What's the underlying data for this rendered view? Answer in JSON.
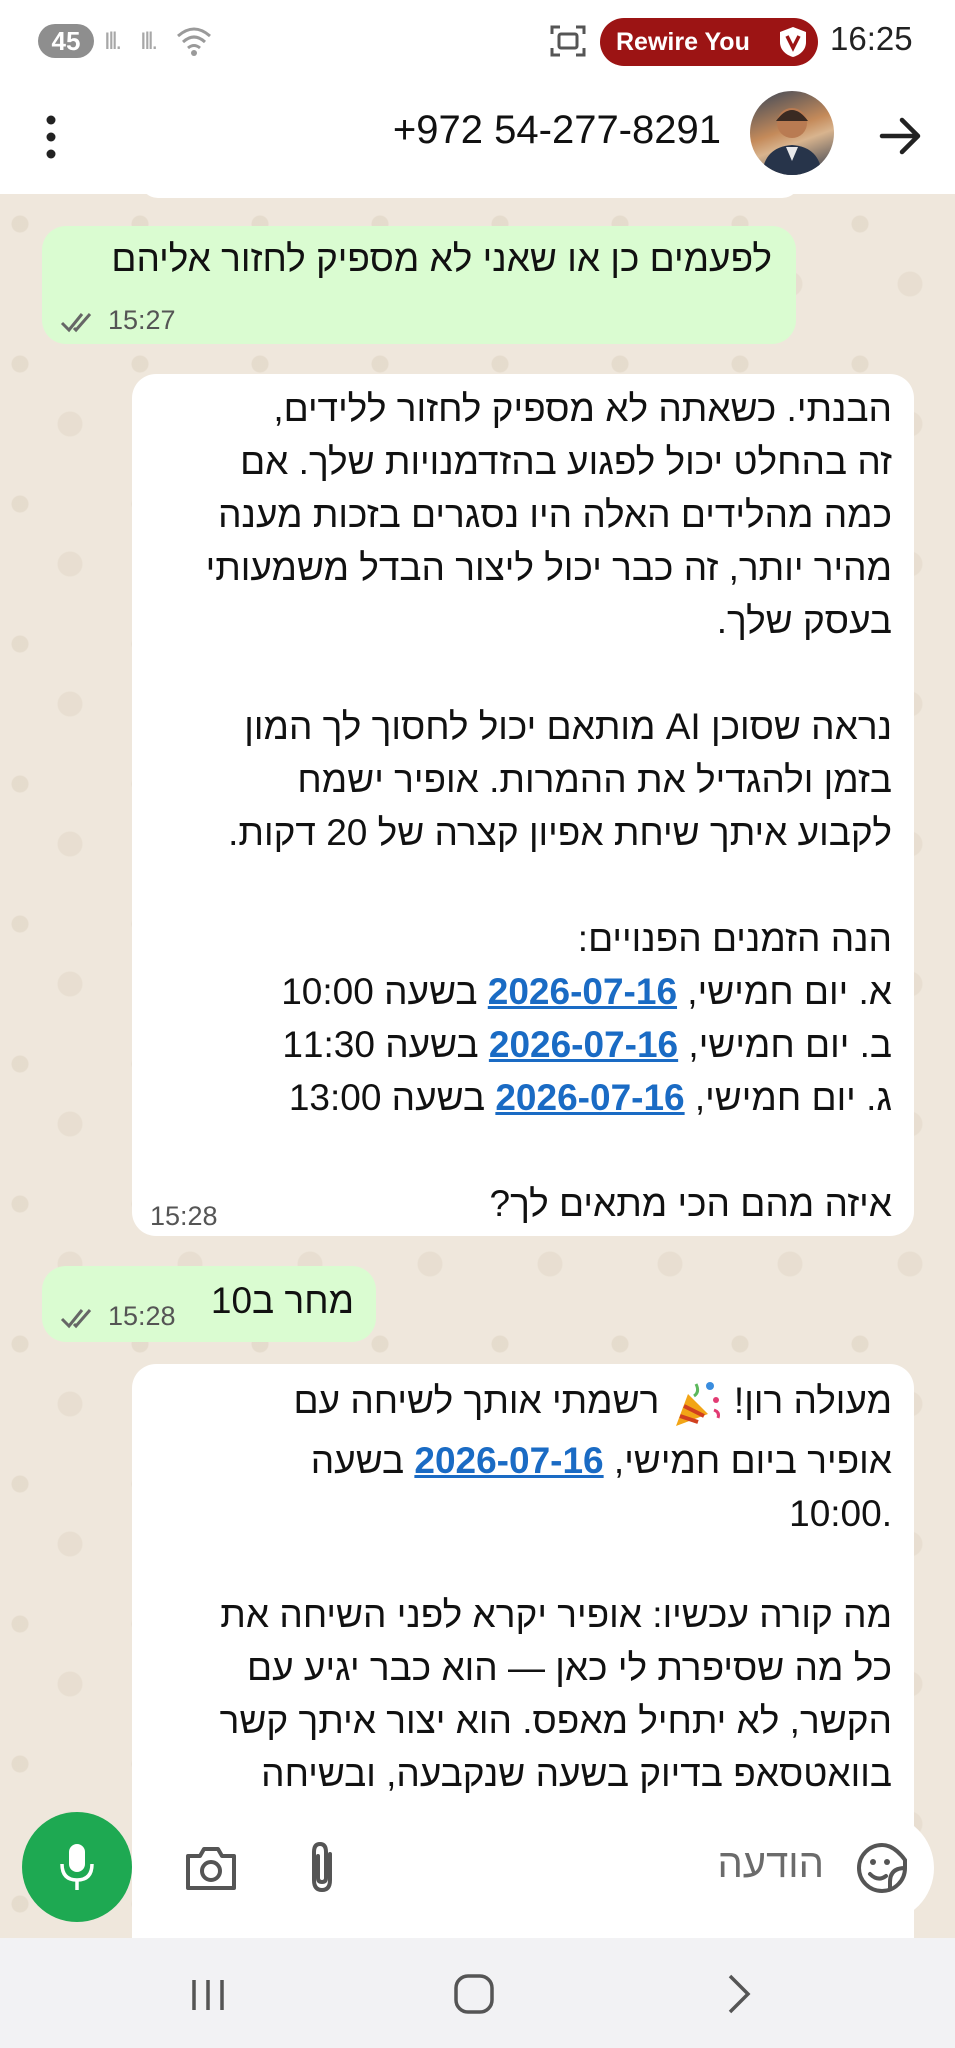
{
  "status_bar": {
    "battery": "45",
    "app_pill": "Rewire You",
    "time": "16:25",
    "signal_1": "Ill.",
    "signal_2": "Ill."
  },
  "header": {
    "contact": "+972 54-277-8291"
  },
  "messages": [
    {
      "direction": "out",
      "lines": [
        "לפעמים כן או שאני לא מספיק לחזור אליהם"
      ],
      "time": "15:27"
    },
    {
      "direction": "in",
      "lines": [
        "הבנתי. כשאתה לא מספיק לחזור ללידים,",
        "זה בהחלט יכול לפגוע בהזדמנויות שלך. אם",
        "כמה מהלידים האלה היו נסגרים בזכות מענה",
        "מהיר יותר, זה כבר יכול ליצור הבדל משמעותי",
        "בעסק שלך.",
        "",
        "נראה שסוכן AI מותאם יכול לחסוך לך המון",
        "בזמן ולהגדיל את ההמרות. אופיר ישמח",
        "לקבוע איתך שיחת אפיון קצרה של 20 דקות.",
        "",
        "הנה הזמנים הפנויים:"
      ],
      "slots": [
        {
          "prefix": "א. יום חמישי, ",
          "date": "2026-07-16",
          "suffix": " בשעה 10:00"
        },
        {
          "prefix": "ב. יום חמישי, ",
          "date": "2026-07-16",
          "suffix": " בשעה 11:30"
        },
        {
          "prefix": "ג. יום חמישי, ",
          "date": "2026-07-16",
          "suffix": " בשעה 13:00"
        }
      ],
      "closing": "איזה מהם הכי מתאים לך?",
      "time": "15:28"
    },
    {
      "direction": "out",
      "lines": [
        "מחר ב10"
      ],
      "time": "15:28"
    },
    {
      "direction": "in",
      "line1": "מעולה רון! ",
      "line1_after": " רשמתי אותך לשיחה עם",
      "line2_prefix": "אופיר ביום חמישי, ",
      "line2_date": "2026-07-16",
      "line2_suffix": " בשעה",
      "line3": ".10:00",
      "para2": [
        "מה קורה עכשיו: אופיר יקרא לפני השיחה את",
        "כל מה שסיפרת לי כאן — הוא כבר יגיע עם",
        "הקשר, לא יתחיל מאפס. הוא יצור איתך קשר",
        "בוואטסאפ בדיוק בשעה שנקבעה, ובשיחה"
      ]
    }
  ],
  "composer": {
    "placeholder": "הודעה"
  },
  "colors": {
    "outgoing_bubble": "#dafcd1",
    "incoming_bubble": "#ffffff",
    "mic_green": "#1ea952",
    "link_blue": "#1a6bc4",
    "rewire_red": "#9c1414"
  },
  "icons": [
    "screenshot-icon",
    "shield-icon",
    "menu-dots-icon",
    "back-arrow-icon",
    "sticker-icon",
    "paperclip-icon",
    "camera-icon",
    "mic-icon",
    "recents-icon",
    "home-icon",
    "back-icon",
    "party-popper-icon",
    "double-check-icon"
  ]
}
